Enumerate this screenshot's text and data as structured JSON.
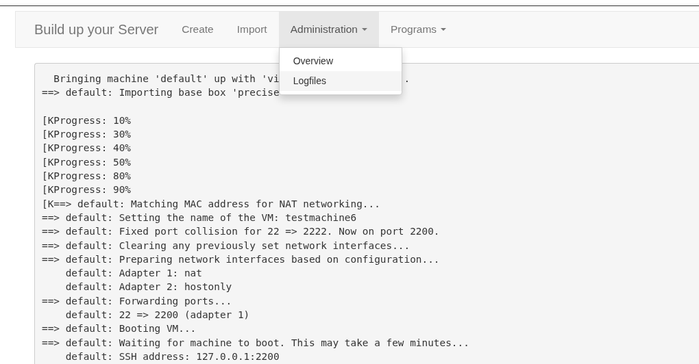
{
  "navbar": {
    "brand": "Build up your Server",
    "items": [
      {
        "label": "Create",
        "selected": false,
        "dropdown": false
      },
      {
        "label": "Import",
        "selected": false,
        "dropdown": false
      },
      {
        "label": "Administration",
        "selected": true,
        "dropdown": true
      },
      {
        "label": "Programs",
        "selected": false,
        "dropdown": true
      }
    ]
  },
  "dropdown_menu": {
    "items": [
      {
        "label": "Overview",
        "highlighted": false
      },
      {
        "label": "Logfiles",
        "highlighted": true
      }
    ]
  },
  "log": {
    "lines": [
      {
        "kind": "text",
        "text": "  Bringing machine 'default' up with 'vi",
        "tail": "."
      },
      {
        "kind": "text",
        "text": "==> default: Importing base box 'precise"
      },
      {
        "kind": "blank"
      },
      {
        "kind": "text",
        "text": "[KProgress: 10%"
      },
      {
        "kind": "text",
        "text": "[KProgress: 30%"
      },
      {
        "kind": "text",
        "text": "[KProgress: 40%"
      },
      {
        "kind": "text",
        "text": "[KProgress: 50%"
      },
      {
        "kind": "text",
        "text": "[KProgress: 80%"
      },
      {
        "kind": "text",
        "text": "[KProgress: 90%"
      },
      {
        "kind": "text",
        "text": "[K==> default: Matching MAC address for NAT networking..."
      },
      {
        "kind": "text",
        "text": "==> default: Setting the name of the VM: testmachine6"
      },
      {
        "kind": "text",
        "text": "==> default: Fixed port collision for 22 => 2222. Now on port 2200."
      },
      {
        "kind": "text",
        "text": "==> default: Clearing any previously set network interfaces..."
      },
      {
        "kind": "text",
        "text": "==> default: Preparing network interfaces based on configuration..."
      },
      {
        "kind": "text",
        "text": "    default: Adapter 1: nat"
      },
      {
        "kind": "text",
        "text": "    default: Adapter 2: hostonly"
      },
      {
        "kind": "text",
        "text": "==> default: Forwarding ports..."
      },
      {
        "kind": "text",
        "text": "    default: 22 => 2200 (adapter 1)"
      },
      {
        "kind": "text",
        "text": "==> default: Booting VM..."
      },
      {
        "kind": "text",
        "text": "==> default: Waiting for machine to boot. This may take a few minutes..."
      },
      {
        "kind": "text",
        "text": "    default: SSH address: 127.0.0.1:2200"
      }
    ]
  }
}
